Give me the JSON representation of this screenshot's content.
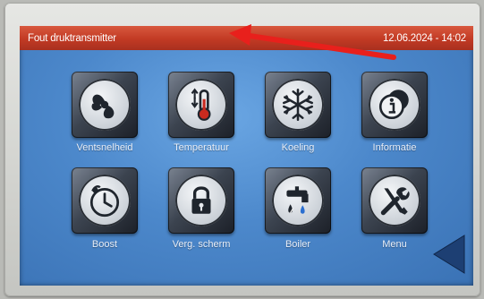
{
  "status_bar": {
    "message": "Fout druktransmitter",
    "datetime": "12.06.2024 - 14:02",
    "color": "#c23a24"
  },
  "menu": {
    "items": [
      {
        "label": "Ventsnelheid",
        "icon": "fan-icon"
      },
      {
        "label": "Temperatuur",
        "icon": "thermometer-icon"
      },
      {
        "label": "Koeling",
        "icon": "snowflake-icon"
      },
      {
        "label": "Informatie",
        "icon": "info-icon"
      },
      {
        "label": "Boost",
        "icon": "clock-icon"
      },
      {
        "label": "Verg. scherm",
        "icon": "lock-icon"
      },
      {
        "label": "Boiler",
        "icon": "faucet-icon"
      },
      {
        "label": "Menu",
        "icon": "tools-icon"
      }
    ]
  },
  "annotation": {
    "color": "#e8201c"
  },
  "screen_bg": "#4c88cb"
}
